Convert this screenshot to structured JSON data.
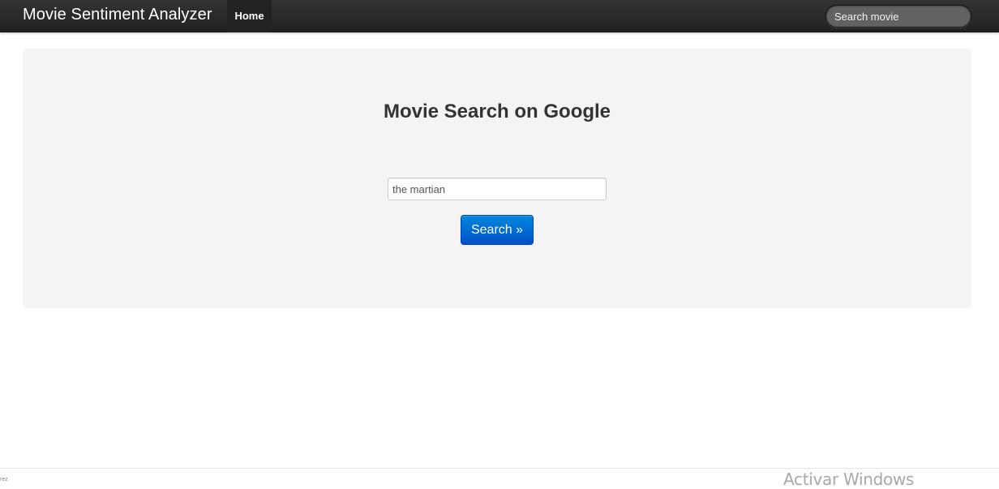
{
  "navbar": {
    "brand": "Movie Sentiment Analyzer",
    "home_label": "Home",
    "search_placeholder": "Search movie"
  },
  "hero": {
    "title": "Movie Search on Google",
    "input_value": "the martian",
    "button_label": "Search »"
  },
  "footer": {
    "text": "rez"
  },
  "watermark": {
    "text": "Activar Windows"
  },
  "colors": {
    "navbar_bg": "#222222",
    "hero_bg": "#f4f4f4",
    "button_primary": "#0068d0",
    "title_text": "#333333"
  }
}
